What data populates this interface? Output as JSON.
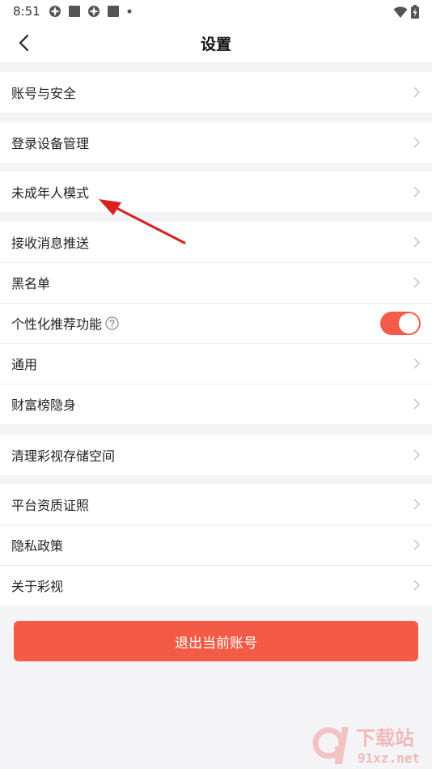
{
  "status_bar": {
    "time": "8:51"
  },
  "header": {
    "title": "设置"
  },
  "groups": [
    {
      "items": [
        {
          "label": "账号与安全"
        }
      ]
    },
    {
      "items": [
        {
          "label": "登录设备管理"
        }
      ]
    },
    {
      "items": [
        {
          "label": "未成年人模式"
        }
      ]
    },
    {
      "items": [
        {
          "label": "接收消息推送"
        },
        {
          "label": "黑名单"
        },
        {
          "label": "个性化推荐功能",
          "toggle_on": true
        },
        {
          "label": "通用"
        },
        {
          "label": "财富榜隐身"
        }
      ]
    },
    {
      "items": [
        {
          "label": "清理彩视存储空间"
        }
      ]
    },
    {
      "items": [
        {
          "label": "平台资质证照"
        },
        {
          "label": "隐私政策"
        },
        {
          "label": "关于彩视"
        }
      ]
    }
  ],
  "logout": {
    "label": "退出当前账号"
  },
  "watermark": {
    "brand_text": "下载站",
    "domain_text": "91xz.net"
  },
  "colors": {
    "accent": "#f45b47",
    "toggle_on": "#f45b4b",
    "background": "#f4f4f6",
    "annotation_arrow": "#d9201d"
  },
  "icons": {
    "back": "chevron-left-icon",
    "row_arrow": "chevron-right-icon",
    "help": "question-circle-icon",
    "wifi": "wifi-icon",
    "battery": "battery-charging-icon"
  }
}
